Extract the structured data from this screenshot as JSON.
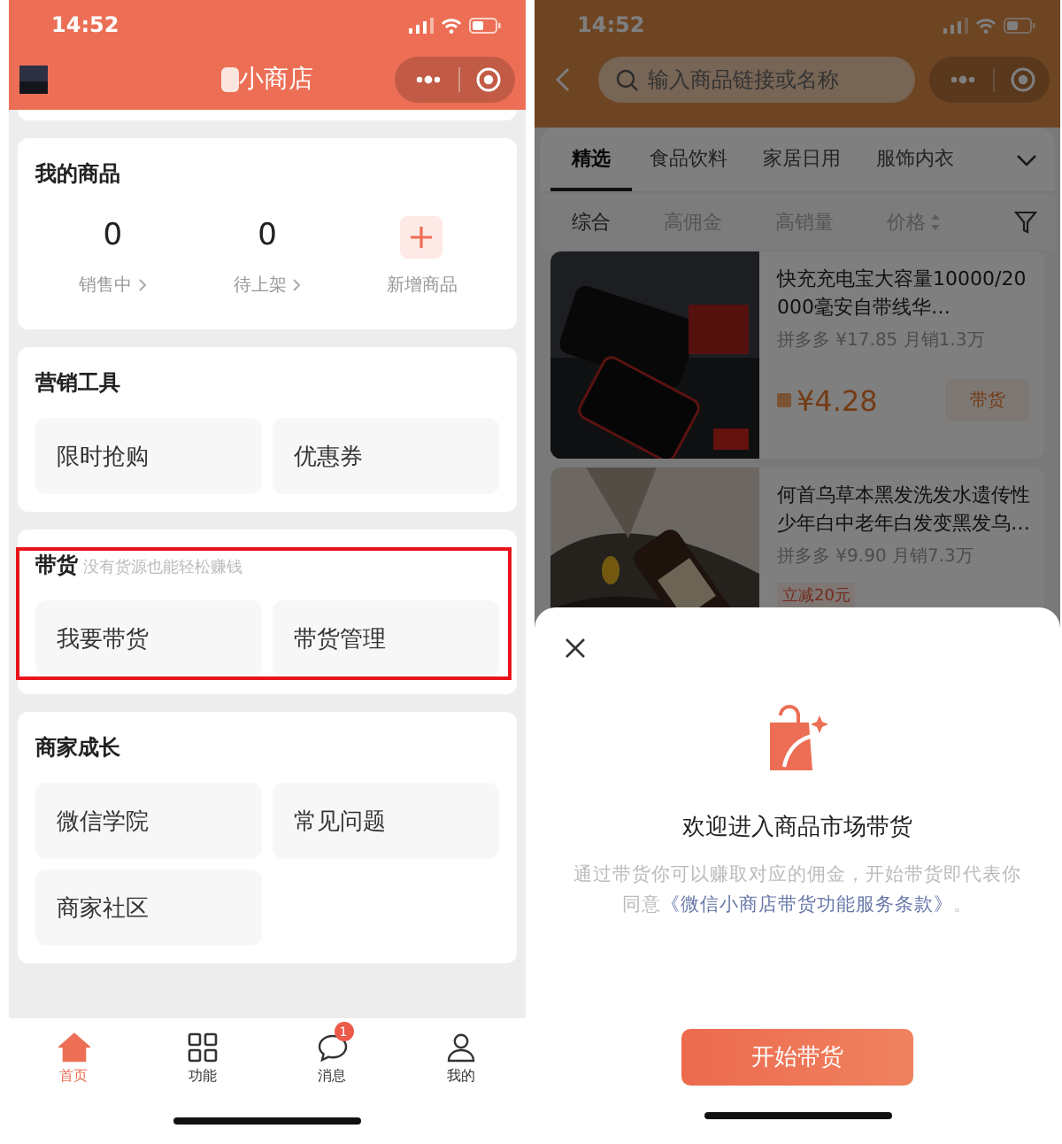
{
  "left_screen": {
    "status_bar": {
      "time": "14:52"
    },
    "nav": {
      "title": "小商店"
    },
    "sections": [
      {
        "kind": "stats",
        "title": "我的商品",
        "highlighted": false,
        "items": [
          {
            "kind": "count",
            "value": "0",
            "label": "销售中"
          },
          {
            "kind": "count",
            "value": "0",
            "label": "待上架"
          },
          {
            "kind": "add",
            "label": "新增商品"
          }
        ]
      },
      {
        "kind": "tiles",
        "title": "营销工具",
        "highlighted": false,
        "tiles": [
          "限时抢购",
          "优惠券"
        ]
      },
      {
        "kind": "tiles",
        "title": "带货",
        "subtitle": "没有货源也能轻松赚钱",
        "highlighted": true,
        "tiles": [
          "我要带货",
          "带货管理"
        ]
      },
      {
        "kind": "tiles",
        "title": "商家成长",
        "highlighted": false,
        "tiles": [
          "微信学院",
          "常见问题",
          "商家社区"
        ]
      }
    ],
    "tab_bar": [
      {
        "label": "首页",
        "selected": true
      },
      {
        "label": "功能",
        "selected": false
      },
      {
        "label": "消息",
        "selected": false,
        "badge": "1"
      },
      {
        "label": "我的",
        "selected": false
      }
    ]
  },
  "right_screen": {
    "status_bar": {
      "time": "14:52"
    },
    "search": {
      "placeholder": "输入商品链接或名称"
    },
    "categories": [
      {
        "label": "精选",
        "selected": true
      },
      {
        "label": "食品饮料",
        "selected": false
      },
      {
        "label": "家居日用",
        "selected": false
      },
      {
        "label": "服饰内衣",
        "selected": false
      }
    ],
    "sort_options": [
      {
        "label": "综合",
        "selected": true
      },
      {
        "label": "高佣金",
        "selected": false
      },
      {
        "label": "高销量",
        "selected": false
      },
      {
        "label": "价格",
        "selected": false
      }
    ],
    "products": [
      {
        "title": "快充充电宝大容量10000/20000毫安自带线华…",
        "meta": "拼多多 ¥17.85 月销1.3万",
        "commission": "¥4.28",
        "action": "带货"
      },
      {
        "title": "何首乌草本黑发洗发水遗传性少年白中老年白发变黑发乌…",
        "meta": "拼多多 ¥9.90 月销7.3万",
        "tag": "立减20元"
      }
    ],
    "sheet": {
      "title": "欢迎进入商品市场带货",
      "body": "通过带货你可以赚取对应的佣金，开始带货即代表你同意",
      "link": "《微信小商店带货功能服务条款》",
      "end": "。",
      "button": "开始带货"
    }
  }
}
